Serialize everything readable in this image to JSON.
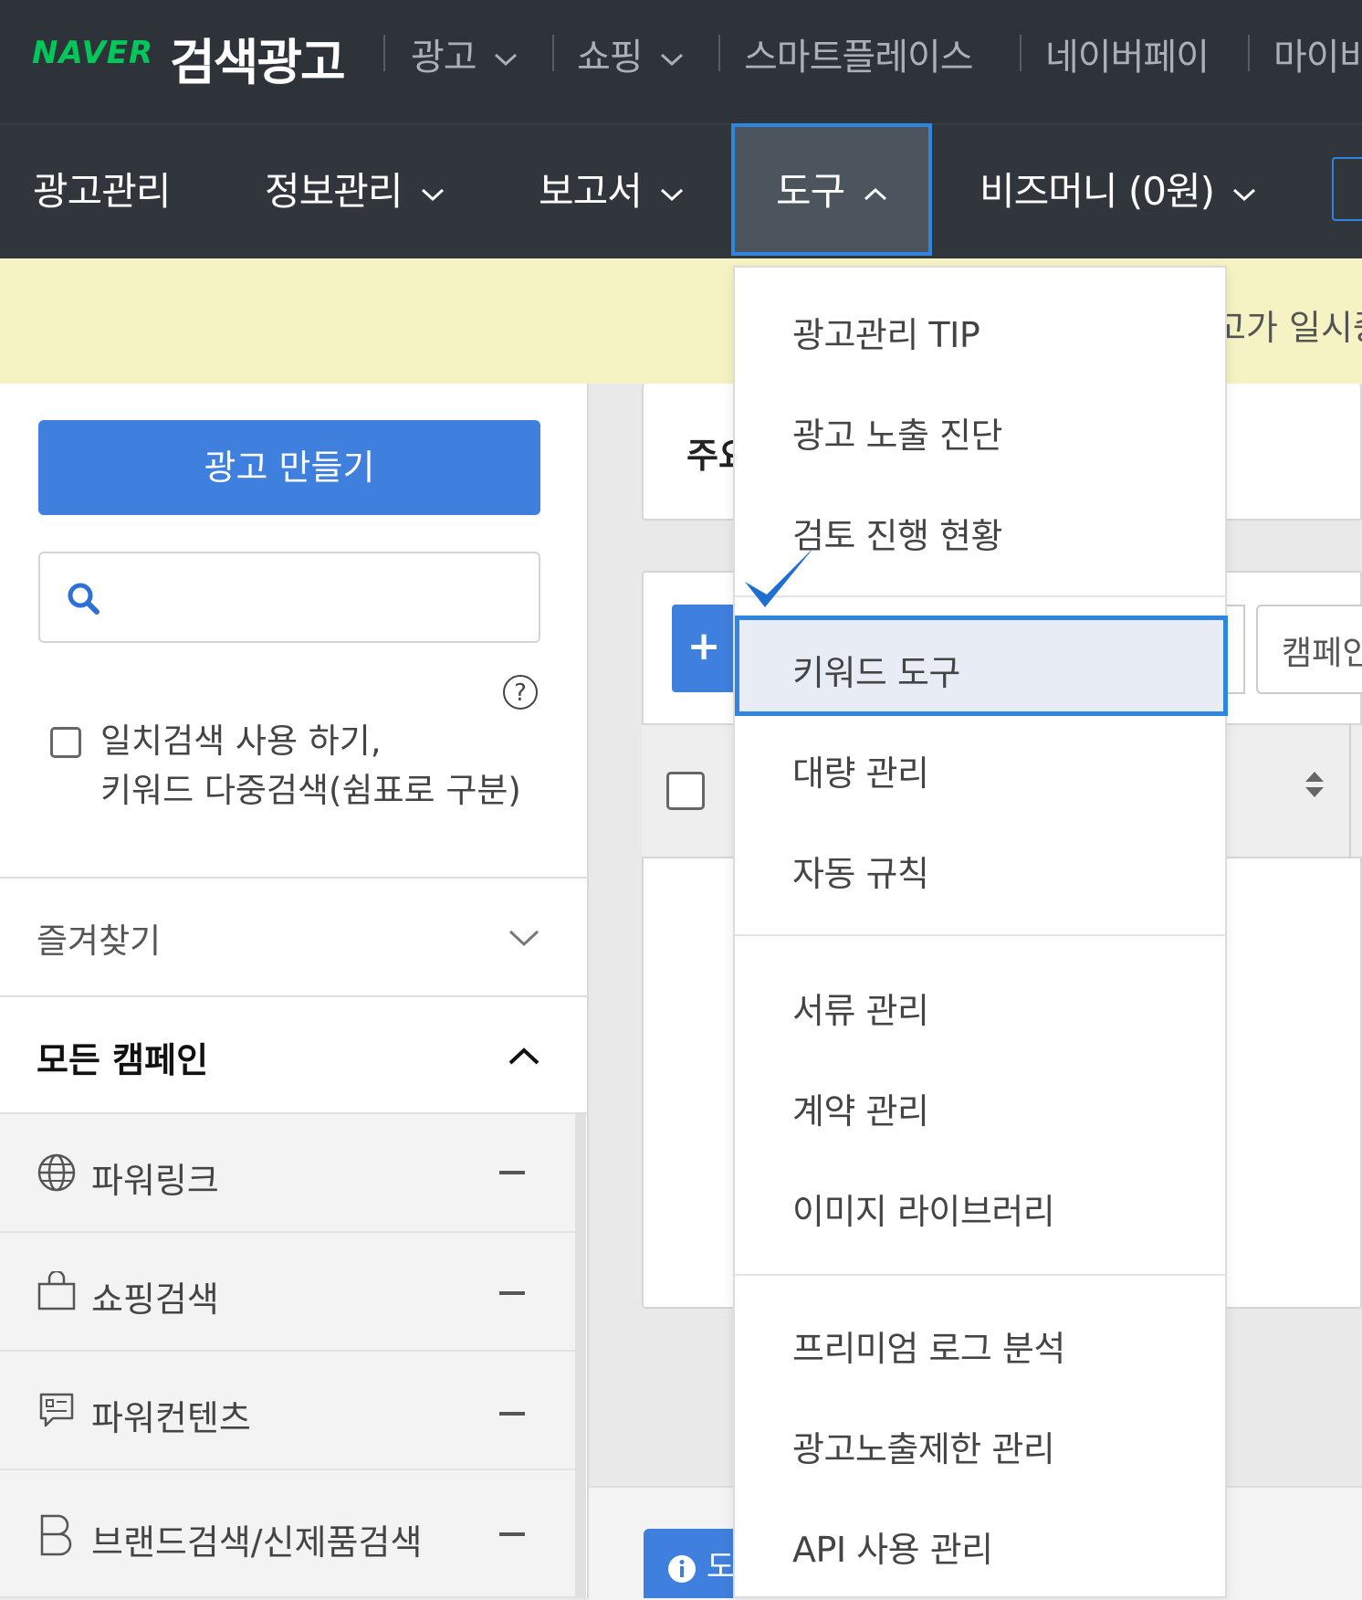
{
  "topbar": {
    "logo_brand": "NAVER",
    "logo_title": "검색광고",
    "links": [
      "광고",
      "쇼핑",
      "스마트플레이스",
      "네이버페이",
      "마이비"
    ]
  },
  "navbar": {
    "items": [
      "광고관리",
      "정보관리",
      "보고서",
      "도구",
      "비즈머니 (0원)"
    ]
  },
  "notice": {
    "text": "고가 일시중"
  },
  "sidebar": {
    "create_button": "광고 만들기",
    "search_placeholder": "",
    "help": "?",
    "exact_search_line1": "일치검색 사용 하기,",
    "exact_search_line2": "키워드 다중검색(쉼표로 구분)",
    "favorites": "즐겨찾기",
    "all_campaigns": "모든 캠페인",
    "campaign_types": [
      "파워링크",
      "쇼핑검색",
      "파워컨텐츠",
      "브랜드검색/신제품검색"
    ]
  },
  "main": {
    "partial_label": "주요",
    "plus": "+",
    "campaign_button": "캠페인",
    "info_button": "도"
  },
  "dropdown": {
    "group1": [
      "광고관리 TIP",
      "광고 노출 진단",
      "검토 진행 현황"
    ],
    "group2": [
      "키워드 도구",
      "대량 관리",
      "자동 규칙"
    ],
    "group3": [
      "서류 관리",
      "계약 관리",
      "이미지 라이브러리"
    ],
    "group4": [
      "프리미엄 로그 분석",
      "광고노출제한 관리",
      "API 사용 관리"
    ],
    "selected": "키워드 도구"
  },
  "colors": {
    "accent": "#2f86e0",
    "button_blue": "#3f7fdd",
    "naver_green": "#03c75a",
    "header_bg": "#2e3339"
  }
}
